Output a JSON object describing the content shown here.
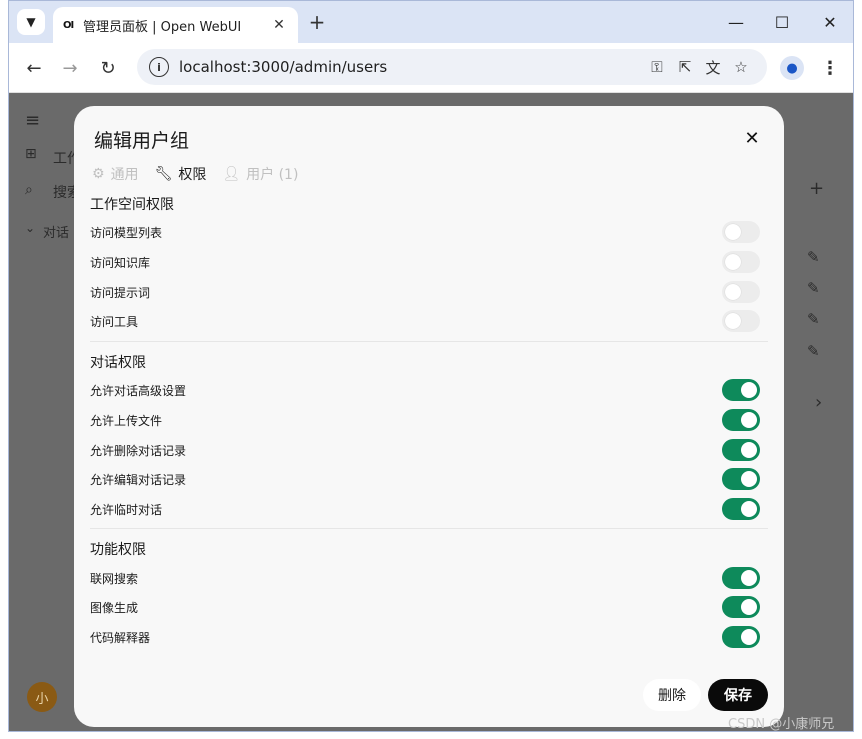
{
  "browser": {
    "tab_title": "管理员面板 | Open WebUI",
    "tab_favicon": "OI",
    "url": "localhost:3000/admin/users"
  },
  "background_page": {
    "sidebar_workspace": "工作",
    "sidebar_search": "搜索",
    "sidebar_chats": "对话",
    "avatar_initial": "小"
  },
  "modal": {
    "title": "编辑用户组",
    "tabs": [
      {
        "label": "通用",
        "icon": "gear-icon"
      },
      {
        "label": "权限",
        "icon": "wrench-icon"
      },
      {
        "label": "用户 (1)",
        "icon": "user-add-icon"
      }
    ],
    "sections": [
      {
        "title": "工作空间权限",
        "items": [
          {
            "label": "访问模型列表",
            "enabled": false
          },
          {
            "label": "访问知识库",
            "enabled": false
          },
          {
            "label": "访问提示词",
            "enabled": false
          },
          {
            "label": "访问工具",
            "enabled": false
          }
        ]
      },
      {
        "title": "对话权限",
        "items": [
          {
            "label": "允许对话高级设置",
            "enabled": true
          },
          {
            "label": "允许上传文件",
            "enabled": true
          },
          {
            "label": "允许删除对话记录",
            "enabled": true
          },
          {
            "label": "允许编辑对话记录",
            "enabled": true
          },
          {
            "label": "允许临时对话",
            "enabled": true
          }
        ]
      },
      {
        "title": "功能权限",
        "items": [
          {
            "label": "联网搜索",
            "enabled": true
          },
          {
            "label": "图像生成",
            "enabled": true
          },
          {
            "label": "代码解释器",
            "enabled": true
          }
        ]
      }
    ],
    "delete_label": "删除",
    "save_label": "保存"
  },
  "watermark": "CSDN @小康师兄",
  "colors": {
    "toggle_on": "#0e8a5b",
    "toggle_off": "#ececec",
    "save_button": "#0a0a0a"
  }
}
